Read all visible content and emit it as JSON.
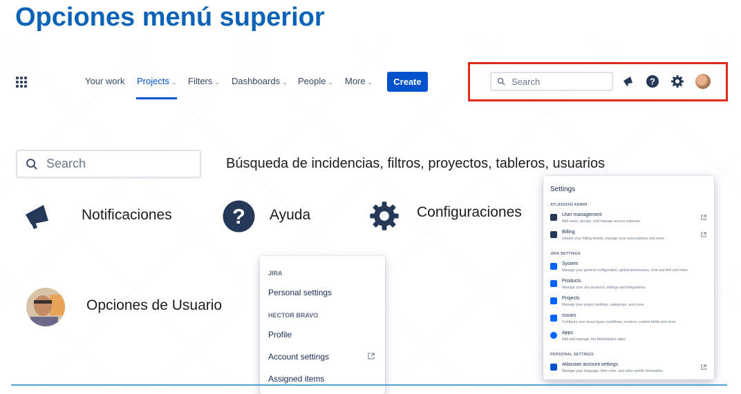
{
  "slide_title": "Opciones menú superior",
  "nav": {
    "items": [
      {
        "label": "Your work",
        "chevron": false
      },
      {
        "label": "Projects",
        "chevron": true,
        "active": true
      },
      {
        "label": "Filters",
        "chevron": true
      },
      {
        "label": "Dashboards",
        "chevron": true
      },
      {
        "label": "People",
        "chevron": true
      },
      {
        "label": "More",
        "chevron": true
      }
    ],
    "create_label": "Create",
    "search_placeholder": "Search",
    "icons": [
      "app-switcher-icon",
      "megaphone-icon",
      "help-icon",
      "gear-icon",
      "avatar"
    ]
  },
  "legend": {
    "search_placeholder": "Search",
    "search_desc": "Búsqueda de incidencias, filtros, proyectos, tableros, usuarios",
    "notifications_label": "Notificaciones",
    "help_label": "Ayuda",
    "settings_label": "Configuraciones",
    "user_options_label": "Opciones de Usuario"
  },
  "user_menu": {
    "jira_heading": "JIRA",
    "personal_settings": "Personal settings",
    "user_heading": "HECTOR BRAVO",
    "profile": "Profile",
    "account_settings": "Account settings",
    "assigned_items": "Assigned items"
  },
  "settings_panel": {
    "title": "Settings",
    "admin_heading": "ATLASSIAN ADMIN",
    "admin_items": [
      {
        "title": "User management",
        "desc": "Add users, groups, and manage access requests."
      },
      {
        "title": "Billing",
        "desc": "Update your billing details, manage your subscriptions and more."
      }
    ],
    "jira_heading": "JIRA SETTINGS",
    "jira_items": [
      {
        "title": "System",
        "desc": "Manage your general configuration, global permissions, look and feel and more."
      },
      {
        "title": "Products",
        "desc": "Manage your Jira products' settings and integrations."
      },
      {
        "title": "Projects",
        "desc": "Manage your project settings, categories, and more."
      },
      {
        "title": "Issues",
        "desc": "Configure your issue types, workflows, screens, custom fields and more."
      },
      {
        "title": "Apps",
        "desc": "Add and manage Jira Marketplace apps."
      }
    ],
    "personal_heading": "PERSONAL SETTINGS",
    "personal_items": [
      {
        "title": "Atlassian account settings",
        "desc": "Manage your language, time zone, and other profile information."
      }
    ]
  },
  "colors": {
    "title_blue": "#0b63b8",
    "jira_blue": "#0052cc",
    "highlight_red": "#e0291c",
    "icon_navy": "#253858"
  }
}
